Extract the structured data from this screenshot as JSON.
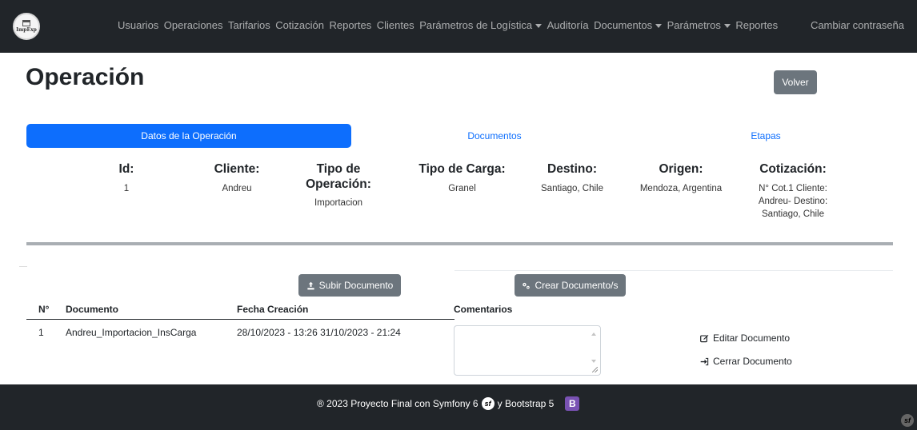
{
  "navbar": {
    "logo_text": "ImpExp",
    "links": [
      {
        "label": "Usuarios",
        "dropdown": false
      },
      {
        "label": "Operaciones",
        "dropdown": false
      },
      {
        "label": "Tarifarios",
        "dropdown": false
      },
      {
        "label": "Cotización",
        "dropdown": false
      },
      {
        "label": "Reportes",
        "dropdown": false
      },
      {
        "label": "Clientes",
        "dropdown": false
      },
      {
        "label": "Parámetros de Logística",
        "dropdown": true
      },
      {
        "label": "Auditoría",
        "dropdown": false
      },
      {
        "label": "Documentos",
        "dropdown": true
      },
      {
        "label": "Parámetros",
        "dropdown": true
      },
      {
        "label": "Reportes",
        "dropdown": false
      }
    ],
    "right_link": "Cambiar contraseña"
  },
  "page": {
    "title": "Operación",
    "back_button": "Volver"
  },
  "tabs": [
    {
      "label": "Datos de la Operación",
      "active": true
    },
    {
      "label": "Documentos",
      "active": false
    },
    {
      "label": "Etapas",
      "active": false
    }
  ],
  "operation": {
    "id": {
      "label": "Id:",
      "value": "1"
    },
    "cliente": {
      "label": "Cliente:",
      "value": "Andreu"
    },
    "tipo_operacion": {
      "label_line1": "Tipo de",
      "label_line2": "Operación:",
      "value": "Importacion"
    },
    "tipo_carga": {
      "label": "Tipo de Carga:",
      "value": "Granel"
    },
    "destino": {
      "label": "Destino:",
      "value": "Santiago, Chile"
    },
    "origen": {
      "label": "Origen:",
      "value": "Mendoza, Argentina"
    },
    "cotizacion": {
      "label": "Cotización:",
      "value_line1": "N° Cot.1 Cliente:",
      "value_line2": "Andreu- Destino:",
      "value_line3": "Santiago, Chile"
    }
  },
  "actions": {
    "upload_button": "Subir Documento",
    "create_button": "Crear Documento/s"
  },
  "documents_table": {
    "headers": {
      "n": "N°",
      "documento": "Documento",
      "fecha": "Fecha Creación",
      "comentarios": "Comentarios"
    },
    "rows": [
      {
        "n": "1",
        "documento": "Andreu_Importacion_InsCarga",
        "fecha": "28/10/2023 - 13:26 31/10/2023 - 21:24",
        "comentario": "",
        "edit_label": "Editar Documento",
        "close_label": "Cerrar Documento"
      }
    ]
  },
  "footer": {
    "text_before": "® 2023 Proyecto Final con Symfony 6",
    "sf_mark": "sf",
    "text_after": "y Bootstrap 5",
    "bs_mark": "B"
  },
  "colors": {
    "navbar_bg": "#212529",
    "primary": "#0d6efd",
    "secondary_button": "#6c757d",
    "divider": "#a9aeb3",
    "bootstrap_purple": "#7952b3"
  }
}
